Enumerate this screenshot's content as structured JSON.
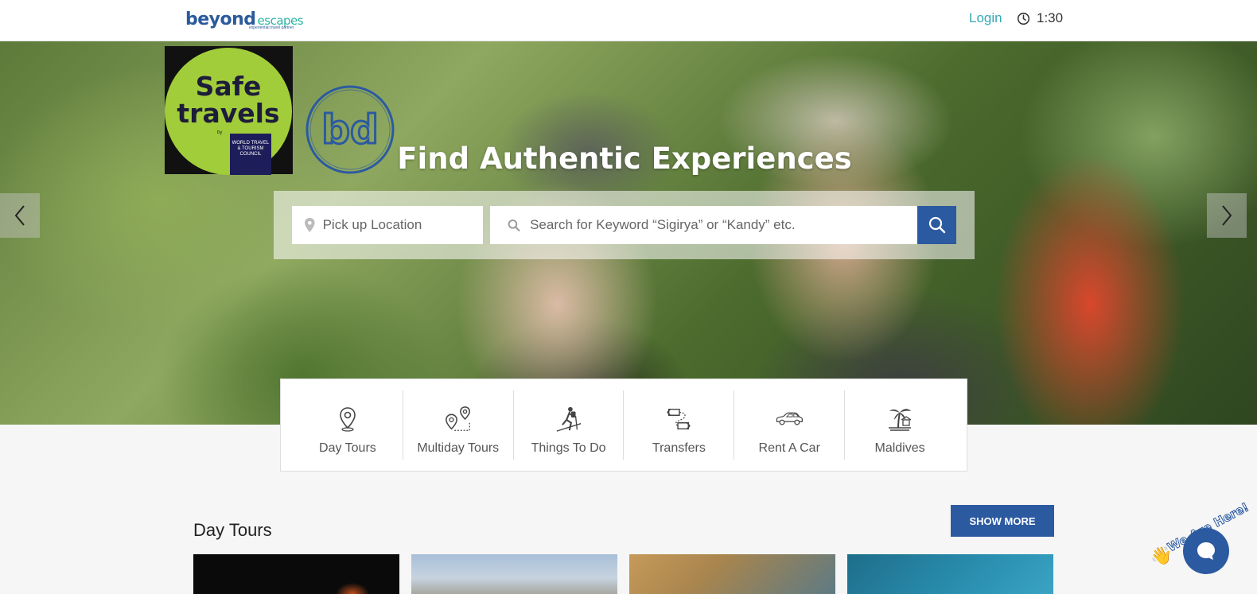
{
  "header": {
    "logo_primary": "beyond",
    "logo_secondary": "escapes",
    "logo_tagline": "experiential travel partner",
    "login_label": "Login",
    "clock_time": "1:30"
  },
  "hero": {
    "badge_text": "Safe travels",
    "badge_by": "by",
    "badge_org": "WORLD TRAVEL & TOURISM COUNCIL",
    "bd_logo_text": "bd",
    "title": "Find Authentic Experiences",
    "pickup_placeholder": "Pick up Location",
    "keyword_placeholder": "Search for Keyword “Sigirya” or “Kandy” etc."
  },
  "categories": [
    {
      "label": "Day Tours",
      "icon": "location-pin-icon"
    },
    {
      "label": "Multiday Tours",
      "icon": "route-icon"
    },
    {
      "label": "Things To Do",
      "icon": "hiker-icon"
    },
    {
      "label": "Transfers",
      "icon": "transfer-icon"
    },
    {
      "label": "Rent A Car",
      "icon": "car-icon"
    },
    {
      "label": "Maldives",
      "icon": "palm-island-icon"
    }
  ],
  "day_tours": {
    "title": "Day Tours",
    "show_more_label": "SHOW MORE"
  },
  "chat": {
    "label": "We Are Here!"
  },
  "colors": {
    "brand_blue": "#2c5aa0",
    "teal": "#35a8b4",
    "badge_green": "#a2cd3a"
  }
}
